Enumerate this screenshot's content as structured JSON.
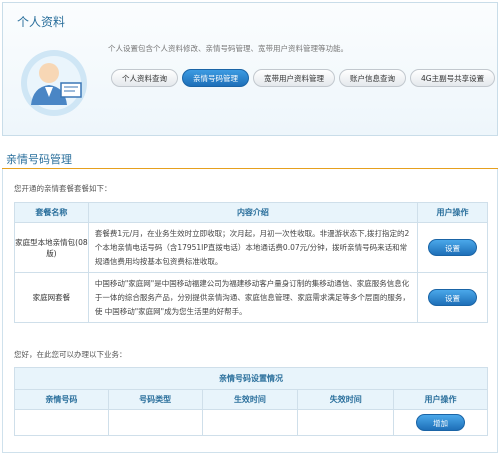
{
  "header": {
    "title": "个人资料",
    "description": "个人设置包含个人资料修改、亲情号码管理、宽带用户资料管理等功能。",
    "tabs": [
      {
        "label": "个人资料查询",
        "active": false
      },
      {
        "label": "亲情号码管理",
        "active": true
      },
      {
        "label": "宽带用户资料管理",
        "active": false
      },
      {
        "label": "账户信息查询",
        "active": false
      },
      {
        "label": "4G主副号共享设置",
        "active": false
      }
    ]
  },
  "section": {
    "title": "亲情号码管理",
    "subscribed_note": "您开通的亲情套餐套餐如下：",
    "table1": {
      "headers": [
        "套餐名称",
        "内容介绍",
        "用户操作"
      ],
      "rows": [
        {
          "name": "家庭型本地亲情包(08版)",
          "desc": "套餐费1元/月，在业务生效时立即收取；次月起，月初一次性收取。非漫游状态下,拨打指定的2个本地亲情电话号码（含17951IP直拨电话）本地通话费0.07元/分钟，拨听亲情号码来话和常规通信费用均按基本包资费标准收取。",
          "action": "设置"
        },
        {
          "name": "家庭网套餐",
          "desc": "中国移动\"家庭网\"是中国移动福建公司为福建移动客户量身订制的集移动通信、家庭服务信息化于一体的综合服务产品，分别提供亲情沟通、家庭信息管理、家庭需求满足等多个层面的服务，使 中国移动\"家庭网\"成为您生活里的好帮手。",
          "action": "设置"
        }
      ]
    },
    "handle_note": "您好，在此您可以办理以下业务：",
    "table2": {
      "caption": "亲情号码设置情况",
      "headers": [
        "亲情号码",
        "号码类型",
        "生效时间",
        "失效时间",
        "用户操作"
      ],
      "add_label": "增加"
    }
  }
}
